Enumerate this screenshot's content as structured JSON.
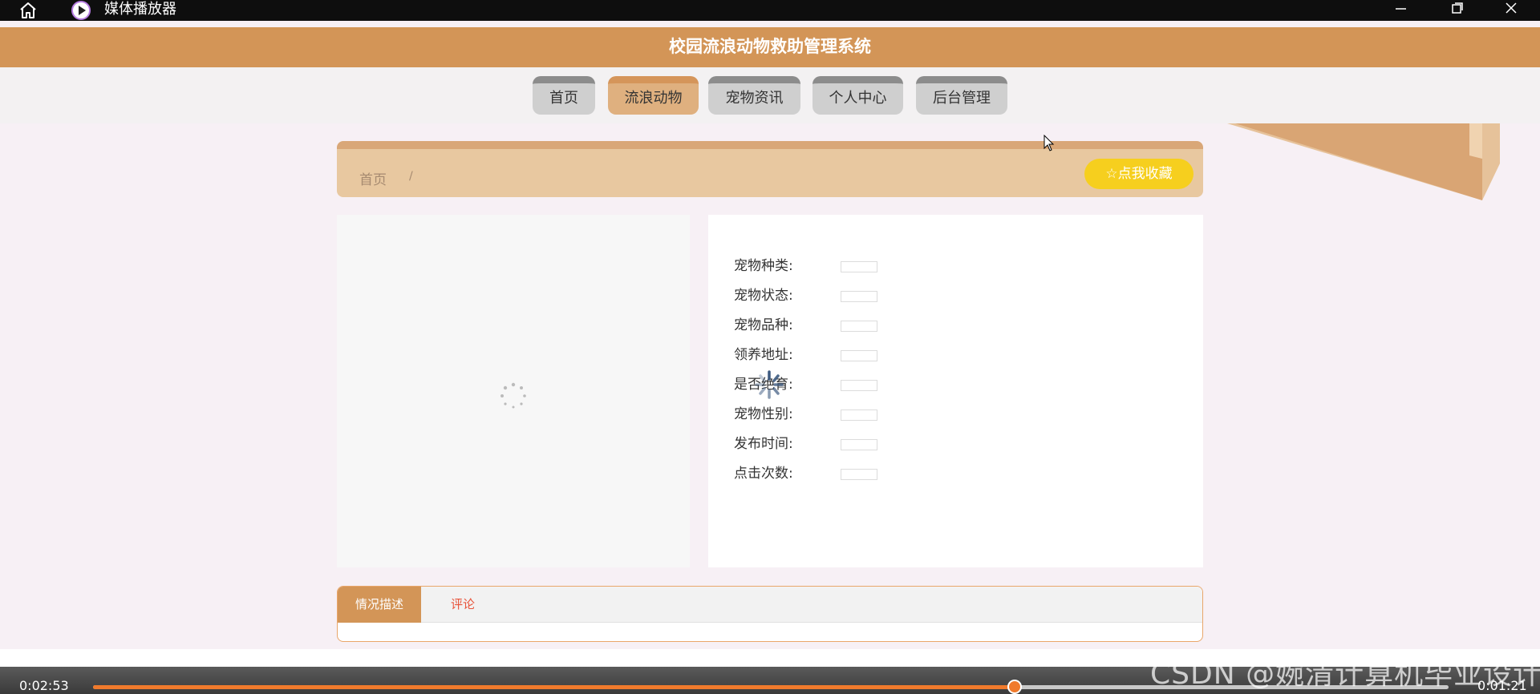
{
  "titlebar": {
    "title": "媒体播放器",
    "icons": [
      "home-icon",
      "media-player-icon",
      "minimize-icon",
      "maximize-icon",
      "close-icon"
    ]
  },
  "site": {
    "title": "校园流浪动物救助管理系统",
    "nav": [
      "首页",
      "流浪动物",
      "宠物资讯",
      "个人中心",
      "后台管理"
    ],
    "active_nav": "流浪动物"
  },
  "breadcrumb": {
    "home": "首页",
    "separator": "/",
    "favorite_label": "点我收藏",
    "favorite_icon": "star-icon"
  },
  "details": {
    "fields": [
      {
        "label": "宠物种类:",
        "value": ""
      },
      {
        "label": "宠物状态:",
        "value": ""
      },
      {
        "label": "宠物品种:",
        "value": ""
      },
      {
        "label": "领养地址:",
        "value": ""
      },
      {
        "label": "是否绝育:",
        "value": ""
      },
      {
        "label": "宠物性别:",
        "value": ""
      },
      {
        "label": "发布时间:",
        "value": ""
      },
      {
        "label": "点击次数:",
        "value": ""
      }
    ]
  },
  "tabs": {
    "desc": "情况描述",
    "comment": "评论"
  },
  "player": {
    "elapsed": "0:02:53",
    "remaining": "0:01:21",
    "progress": 0.68,
    "watermark": "CSDN @婉清计算机毕业设计"
  },
  "colors": {
    "brand": "#d39557",
    "favorite": "#f6cf1e",
    "progress": "#f07a2c",
    "comment_tab": "#e8543b"
  }
}
